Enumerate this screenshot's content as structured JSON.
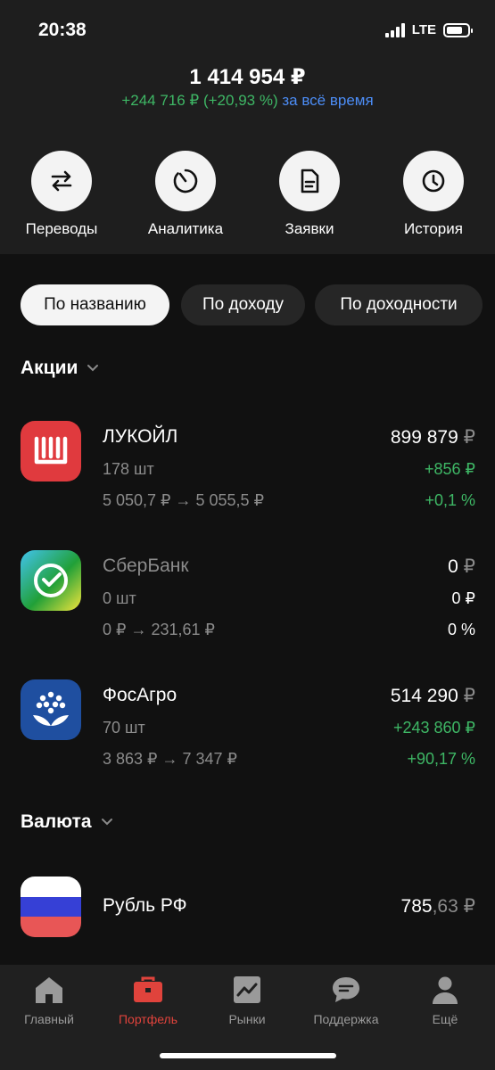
{
  "status": {
    "time": "20:38",
    "network": "LTE"
  },
  "portfolio": {
    "total": "1 414 954 ₽",
    "gain": "+244 716 ₽ (+20,93 %)",
    "period": "за всё время"
  },
  "actions": [
    {
      "label": "Переводы",
      "icon": "transfer-icon"
    },
    {
      "label": "Аналитика",
      "icon": "pie-chart-icon"
    },
    {
      "label": "Заявки",
      "icon": "document-icon"
    },
    {
      "label": "История",
      "icon": "clock-icon"
    }
  ],
  "sort": {
    "chips": [
      "По названию",
      "По доходу",
      "По доходности"
    ],
    "selected": "По названию"
  },
  "sections": {
    "stocks": "Акции",
    "currency": "Валюта"
  },
  "assets": [
    {
      "name": "ЛУКОЙЛ",
      "qty": "178 шт",
      "price_change": "5 050,7 ₽  →  5 055,5 ₽",
      "value": "899 879",
      "currency": "₽",
      "gain": "+856 ₽",
      "pct": "+0,1 %",
      "logo_color": "#e03a3e"
    },
    {
      "name": "СберБанк",
      "qty": "0 шт",
      "price_change": "0 ₽  →  231,61 ₽",
      "value": "0",
      "currency": "₽",
      "gain": "0 ₽",
      "pct": "0 %",
      "logo_color": "#21a038"
    },
    {
      "name": "ФосАгро",
      "qty": "70 шт",
      "price_change": "3 863 ₽  →  7 347 ₽",
      "value": "514 290",
      "currency": "₽",
      "gain": "+243 860 ₽",
      "pct": "+90,17 %",
      "logo_color": "#1f4fa0"
    }
  ],
  "cash": {
    "name": "Рубль РФ",
    "value_int": "785",
    "value_frac": ",63",
    "currency": "₽"
  },
  "tabs": [
    {
      "label": "Главный",
      "icon": "home-icon"
    },
    {
      "label": "Портфель",
      "icon": "briefcase-icon"
    },
    {
      "label": "Рынки",
      "icon": "chart-icon"
    },
    {
      "label": "Поддержка",
      "icon": "chat-icon"
    },
    {
      "label": "Ещё",
      "icon": "profile-icon"
    }
  ],
  "active_tab": "Портфель",
  "colors": {
    "green": "#3eb765",
    "blue": "#4c8df6",
    "accent": "#e0433c"
  }
}
